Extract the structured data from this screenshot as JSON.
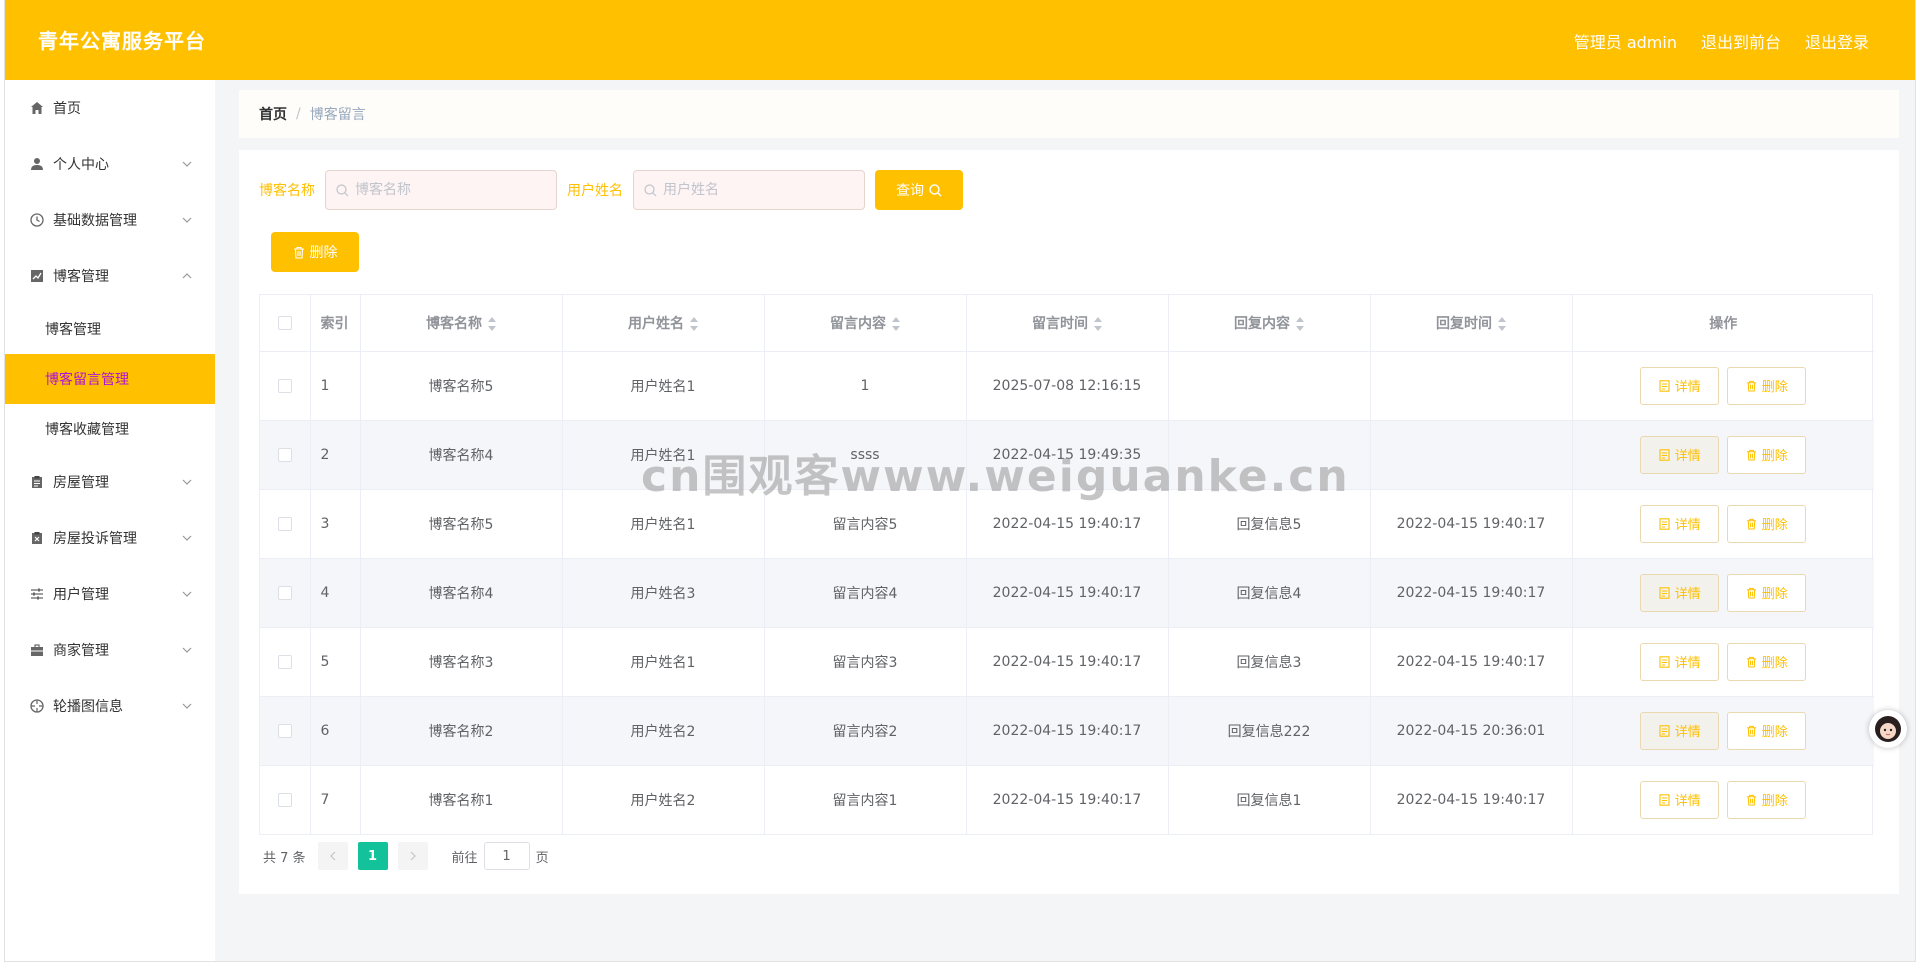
{
  "header": {
    "title": "青年公寓服务平台",
    "user_label": "管理员 admin",
    "exit_front": "退出到前台",
    "logout": "退出登录"
  },
  "sidebar": {
    "items": [
      {
        "label": "首页",
        "icon": "home-icon"
      },
      {
        "label": "个人中心",
        "icon": "user-icon"
      },
      {
        "label": "基础数据管理",
        "icon": "clock-icon"
      },
      {
        "label": "博客管理",
        "icon": "chart-icon"
      },
      {
        "label": "房屋管理",
        "icon": "clipboard-icon"
      },
      {
        "label": "房屋投诉管理",
        "icon": "clipboard-x-icon"
      },
      {
        "label": "用户管理",
        "icon": "sliders-icon"
      },
      {
        "label": "商家管理",
        "icon": "briefcase-icon"
      },
      {
        "label": "轮播图信息",
        "icon": "aperture-icon"
      }
    ],
    "sub_items": [
      "博客管理",
      "博客留言管理",
      "博客收藏管理"
    ],
    "active_sub": "博客留言管理"
  },
  "breadcrumb": {
    "home": "首页",
    "separator": "/",
    "current": "博客留言"
  },
  "search": {
    "blog_label": "博客名称",
    "blog_placeholder": "博客名称",
    "user_label": "用户姓名",
    "user_placeholder": "用户姓名",
    "query_button": "查询",
    "delete_button": "删除"
  },
  "table": {
    "headers": [
      "索引",
      "博客名称",
      "用户姓名",
      "留言内容",
      "留言时间",
      "回复内容",
      "回复时间",
      "操作"
    ],
    "detail_label": "详情",
    "delete_label": "删除",
    "rows": [
      {
        "idx": "1",
        "blog": "博客名称5",
        "user": "用户姓名1",
        "content": "1",
        "time": "2025-07-08 12:16:15",
        "reply": "",
        "reply_time": ""
      },
      {
        "idx": "2",
        "blog": "博客名称4",
        "user": "用户姓名1",
        "content": "ssss",
        "time": "2022-04-15 19:49:35",
        "reply": "",
        "reply_time": ""
      },
      {
        "idx": "3",
        "blog": "博客名称5",
        "user": "用户姓名1",
        "content": "留言内容5",
        "time": "2022-04-15 19:40:17",
        "reply": "回复信息5",
        "reply_time": "2022-04-15 19:40:17"
      },
      {
        "idx": "4",
        "blog": "博客名称4",
        "user": "用户姓名3",
        "content": "留言内容4",
        "time": "2022-04-15 19:40:17",
        "reply": "回复信息4",
        "reply_time": "2022-04-15 19:40:17"
      },
      {
        "idx": "5",
        "blog": "博客名称3",
        "user": "用户姓名1",
        "content": "留言内容3",
        "time": "2022-04-15 19:40:17",
        "reply": "回复信息3",
        "reply_time": "2022-04-15 19:40:17"
      },
      {
        "idx": "6",
        "blog": "博客名称2",
        "user": "用户姓名2",
        "content": "留言内容2",
        "time": "2022-04-15 19:40:17",
        "reply": "回复信息222",
        "reply_time": "2022-04-15 20:36:01"
      },
      {
        "idx": "7",
        "blog": "博客名称1",
        "user": "用户姓名2",
        "content": "留言内容1",
        "time": "2022-04-15 19:40:17",
        "reply": "回复信息1",
        "reply_time": "2022-04-15 19:40:17"
      }
    ]
  },
  "pagination": {
    "total_text": "共 7 条",
    "current_page": "1",
    "goto_label": "前往",
    "goto_value": "1",
    "page_suffix": "页"
  },
  "watermark": "cn围观客www.weiguanke.cn",
  "colors": {
    "accent": "#ffc000",
    "active_text": "#b012d8",
    "page_active": "#13c29a"
  }
}
